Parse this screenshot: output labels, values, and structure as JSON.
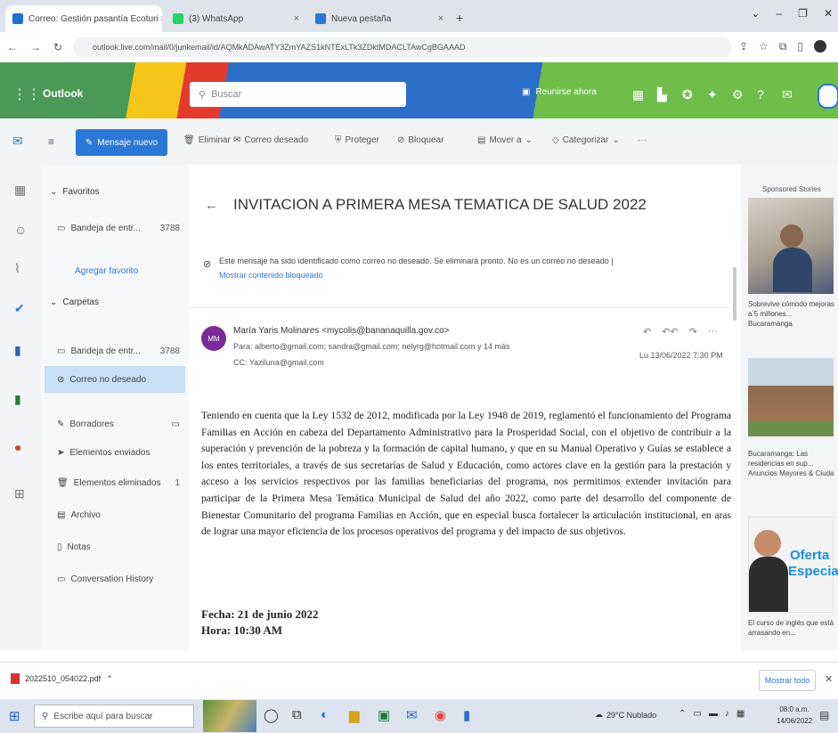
{
  "browser": {
    "tabs": [
      {
        "label": "Correo: Gestión pasantía Ecoturi ×"
      },
      {
        "label": "(3) WhatsApp"
      },
      {
        "label": "Nueva pestaña"
      }
    ],
    "url": "outlook.live.com/mail/0/junkemail/id/AQMkADAwATY3ZmYAZS1kNTExLTk3ZDktMDACLTAwCgBGAAAD"
  },
  "outlook": {
    "app_name": "Outlook",
    "search_placeholder": "Buscar",
    "premium_label": "Reunirse ahora",
    "new_message": "Mensaje nuevo",
    "commands": [
      "Eliminar",
      "Correo deseado",
      "Proteger",
      "Bloquear",
      "Mover a",
      "Categorizar"
    ]
  },
  "folders": {
    "favorites_label": "Favoritos",
    "folders_label": "Carpetas",
    "items": [
      {
        "label": "Bandeja de entr...",
        "count": "3788"
      },
      {
        "label": "Agregar favorito",
        "count": ""
      },
      {
        "label": "Bandeja de entr...",
        "count": "3788"
      },
      {
        "label": "Correo no deseado",
        "count": ""
      },
      {
        "label": "Borradores",
        "count": ""
      },
      {
        "label": "Elementos enviados",
        "count": ""
      },
      {
        "label": "Elementos eliminados",
        "count": "1"
      },
      {
        "label": "Archivo",
        "count": ""
      },
      {
        "label": "Notas",
        "count": ""
      },
      {
        "label": "Conversation History",
        "count": ""
      }
    ]
  },
  "email": {
    "subject": "INVITACION A PRIMERA MESA TEMATICA DE SALUD 2022",
    "junk_notice": "Este mensaje ha sido identificado como correo no deseado. Se eliminará pronto. No es un correo no deseado |",
    "junk_notice_2": "Mostrar contenido bloqueado",
    "avatar_initials": "MM",
    "from": "María Yaris Molinares <mycolis@bananaquilla.gov.co>",
    "to": "Para: alberto@gmail.com; sandra@gmail.com; nelyrg@hotmail.com y 14 más",
    "cc": "CC: Yaziluna@gmail.com",
    "date": "Lu 13/06/2022 7:30 PM",
    "body": "Teniendo en cuenta que la Ley 1532 de 2012, modificada por la Ley 1948 de 2019, reglamentó el funcionamiento del Programa Familias en Acción en cabeza del Departamento Administrativo para la Prosperidad Social, con el objetivo de contribuir a la superación y prevención de la pobreza y la formación de capital humano, y que en su Manual Operativo y Guías se establece a los entes territoriales, a través de sus secretarías de Salud y Educación, como actores clave en la gestión para la prestación y acceso a los servicios respectivos por las familias beneficiarias del programa, nos permitimos extender invitación para participar de la Primera Mesa Temática Municipal de Salud del año 2022, como parte del desarrollo del componente de Bienestar Comunitario del programa Familias en Acción, que en especial busca fortalecer la articulación institucional, en aras de lograr una mayor eficiencia de los procesos operativos del programa y del impacto de sus objetivos.",
    "fecha": "Fecha: 21 de junio 2022",
    "hora": "Hora: 10:30 AM"
  },
  "ads": {
    "header": "Sponsored Stories",
    "items": [
      {
        "caption": "Sobrevive cómodo mejoras a 5 millones... Bucaramanga"
      },
      {
        "caption": "Bucaramanga: Las residencias en sup... Anuncios Mayores & Ciuda"
      },
      {
        "caption": "El curso de inglés que está arrasando en..."
      }
    ],
    "offer_line1": "Oferta",
    "offer_line2": "Especial"
  },
  "downloads": {
    "file": "2022510_054022.pdf",
    "show_all": "Mostrar todo"
  },
  "taskbar": {
    "search_placeholder": "Escribe aquí para buscar",
    "weather": "29°C Nublado",
    "time": "08:0 a.m.",
    "date": "14/06/2022"
  },
  "colors": {
    "outlook_blue": "#2b78d6",
    "selected_folder": "#c8dff5",
    "avatar": "#7b2a9a"
  }
}
